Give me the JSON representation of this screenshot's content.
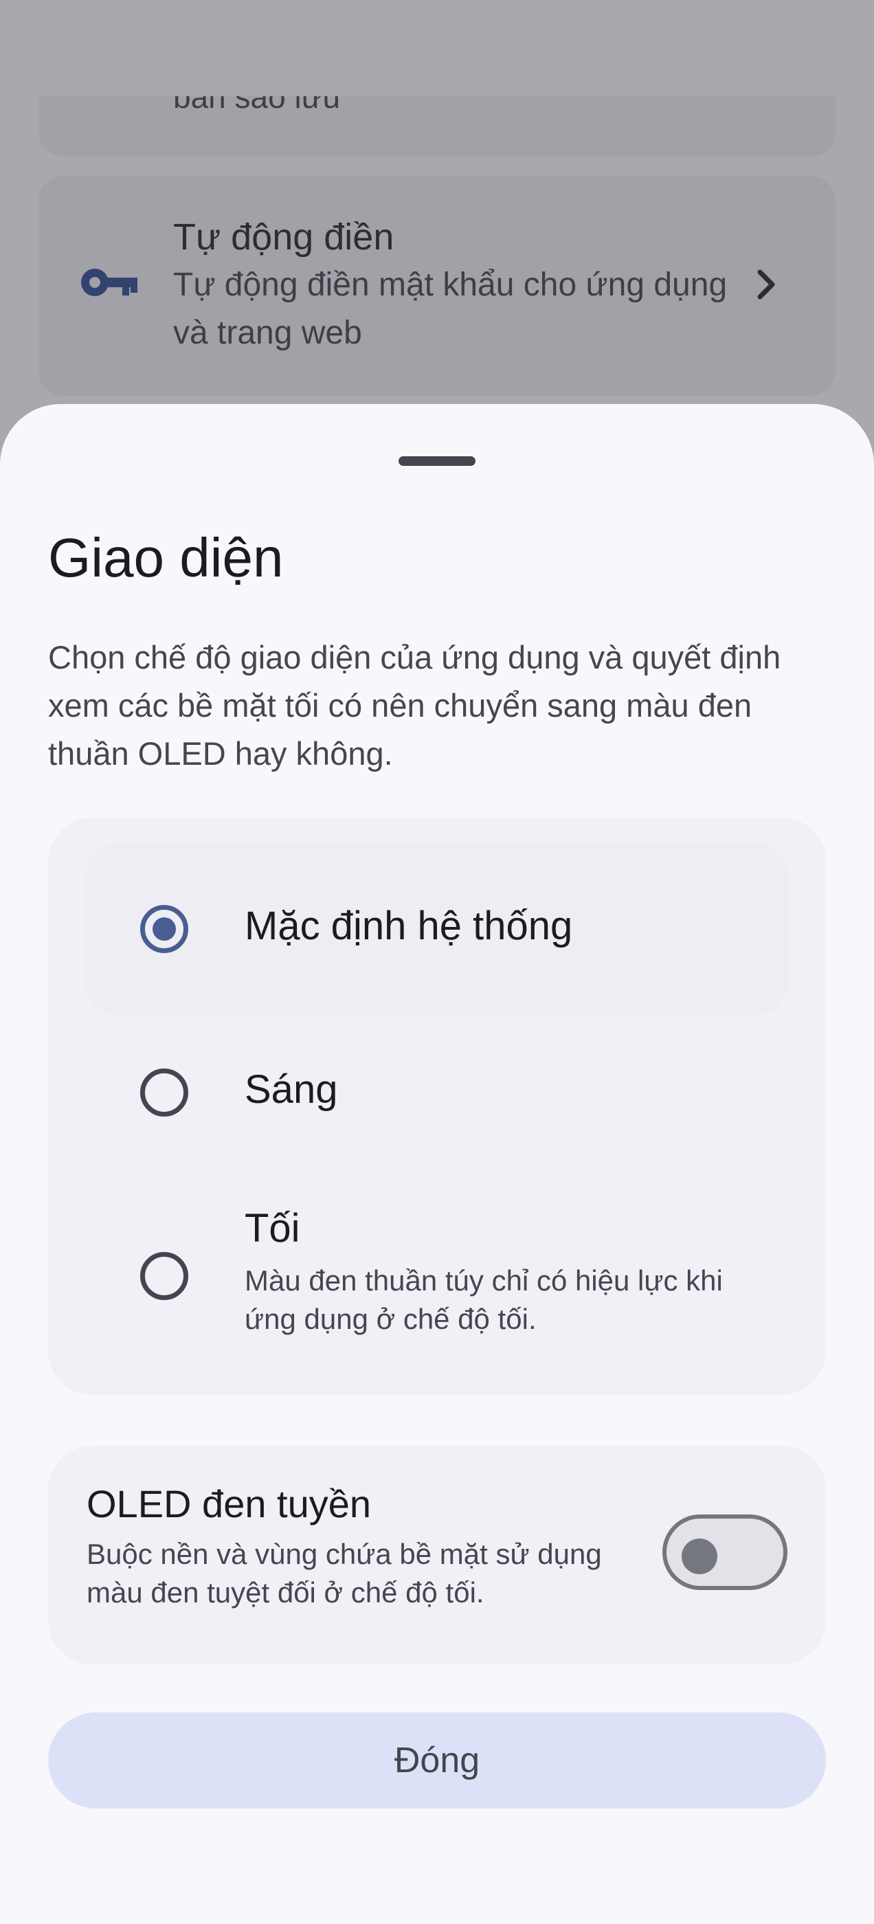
{
  "background": {
    "partial_item_text": "bản sao lưu",
    "autofill": {
      "title": "Tự động điền",
      "description": "Tự động điền mật khẩu cho ứng dụng và trang web",
      "icon": "key-icon",
      "trailing_icon": "chevron-right-icon"
    }
  },
  "sheet": {
    "title": "Giao diện",
    "description": "Chọn chế độ giao diện của ứng dụng và quyết định xem các bề mặt tối có nên chuyển sang màu đen thuần OLED hay không.",
    "options": [
      {
        "label": "Mặc định hệ thống",
        "selected": true
      },
      {
        "label": "Sáng",
        "selected": false
      },
      {
        "label": "Tối",
        "sublabel": "Màu đen thuần túy chỉ có hiệu lực khi ứng dụng ở chế độ tối.",
        "selected": false
      }
    ],
    "oled": {
      "title": "OLED đen tuyền",
      "description": "Buộc nền và vùng chứa bề mặt sử dụng màu đen tuyệt đối ở chế độ tối.",
      "enabled": false
    },
    "close_label": "Đóng"
  },
  "colors": {
    "accent": "#485d92",
    "button_bg": "#dce1f8",
    "scrim": "#a9a8ad"
  }
}
